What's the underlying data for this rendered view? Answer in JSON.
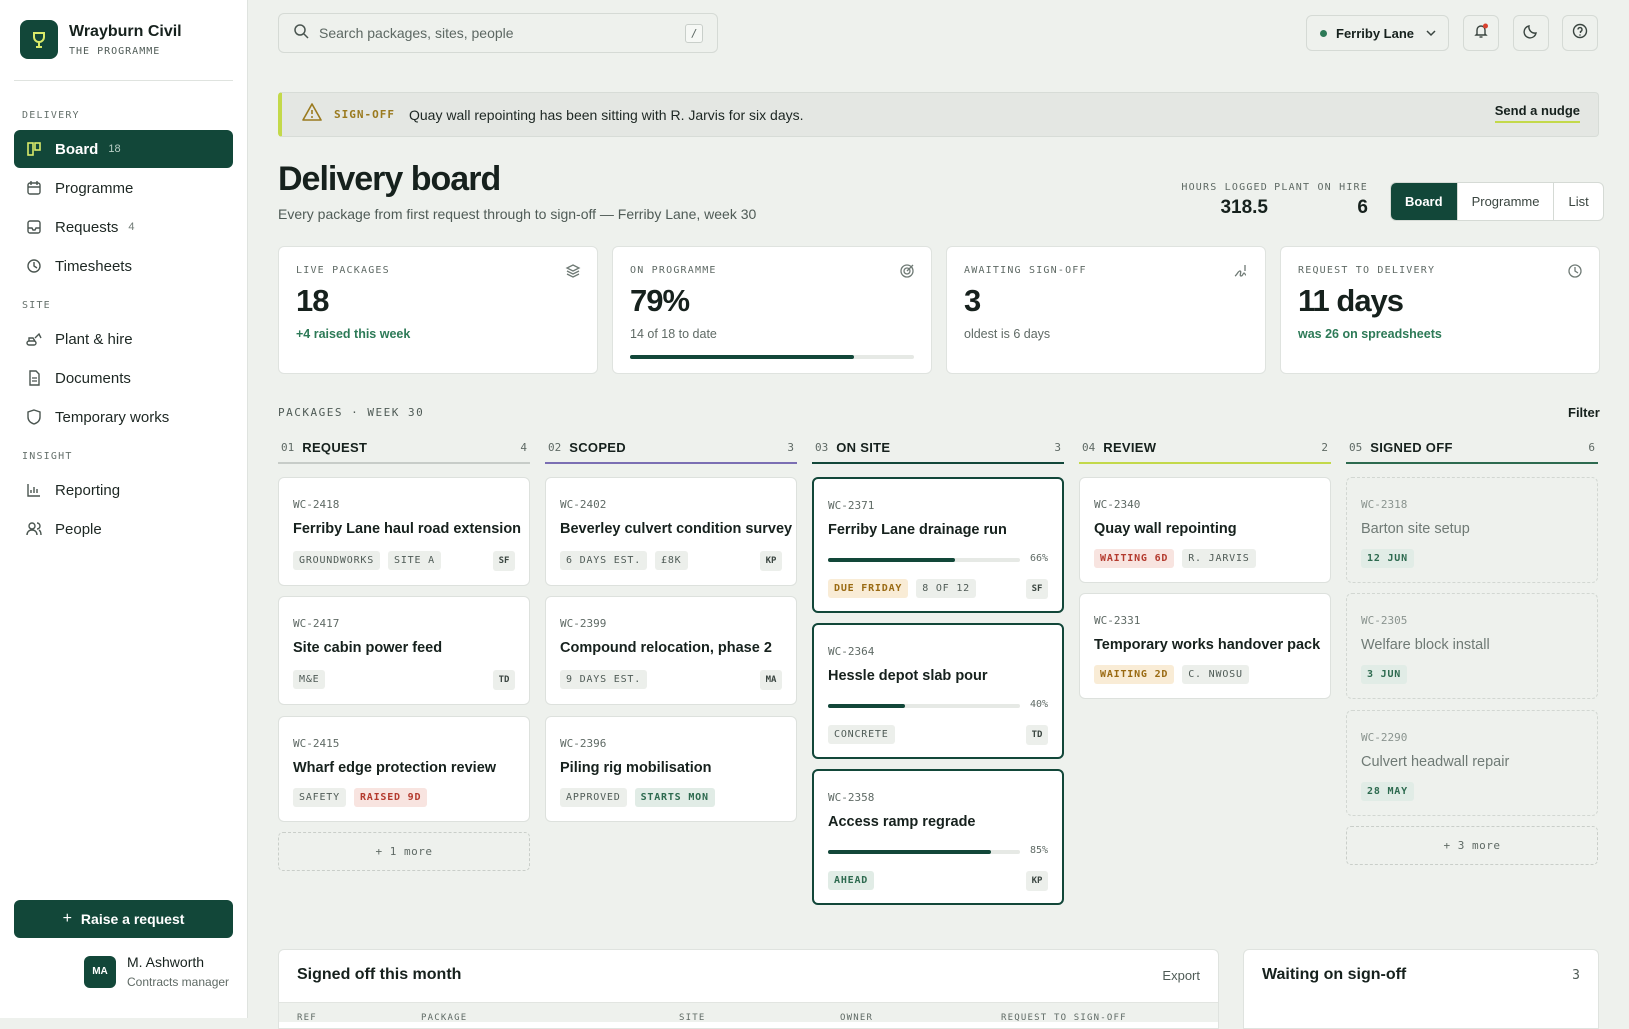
{
  "brand": {
    "name": "Wrayburn Civil",
    "sub": "THE PROGRAMME"
  },
  "sidebar": {
    "sections": [
      "DELIVERY",
      "SITE",
      "INSIGHT"
    ],
    "items": [
      {
        "label": "Board",
        "count": "18",
        "icon": "board-icon"
      },
      {
        "label": "Programme",
        "count": "",
        "icon": "calendar-icon"
      },
      {
        "label": "Requests",
        "count": "4",
        "icon": "inbox-icon"
      },
      {
        "label": "Timesheets",
        "count": "",
        "icon": "clock-icon"
      },
      {
        "label": "Plant & hire",
        "count": "",
        "icon": "excavator-icon"
      },
      {
        "label": "Documents",
        "count": "",
        "icon": "document-icon"
      },
      {
        "label": "Temporary works",
        "count": "",
        "icon": "shield-icon"
      },
      {
        "label": "Reporting",
        "count": "",
        "icon": "chart-icon"
      },
      {
        "label": "People",
        "count": "",
        "icon": "people-icon"
      }
    ],
    "raise_label": "Raise a request",
    "user": {
      "initials": "MA",
      "name": "M. Ashworth",
      "role": "Contracts manager"
    }
  },
  "topbar": {
    "search_placeholder": "Search packages, sites, people",
    "search_key": "/",
    "site": "Ferriby Lane"
  },
  "banner": {
    "tag": "SIGN-OFF",
    "text": "Quay wall repointing has been sitting with R. Jarvis for six days.",
    "action": "Send a nudge"
  },
  "header": {
    "title": "Delivery board",
    "subtitle": "Every package from first request through to sign-off — Ferriby Lane, week 30",
    "hours_label": "HOURS LOGGED",
    "hours_value": "318.5",
    "plant_label": "PLANT ON HIRE",
    "plant_value": "6",
    "views": [
      "Board",
      "Programme",
      "List"
    ]
  },
  "kpis": [
    {
      "label": "LIVE PACKAGES",
      "value": "18",
      "note": "+4 raised this week",
      "icon": "layers-icon"
    },
    {
      "label": "ON PROGRAMME",
      "value": "79%",
      "note": "14 of 18 to date",
      "icon": "target-icon",
      "progress": 0.79
    },
    {
      "label": "AWAITING SIGN-OFF",
      "value": "3",
      "note": "oldest is 6 days",
      "icon": "signature-icon"
    },
    {
      "label": "REQUEST TO DELIVERY",
      "value": "11 days",
      "note": "was 26 on spreadsheets",
      "icon": "history-icon"
    }
  ],
  "board": {
    "label": "PACKAGES · WEEK 30",
    "filter": "Filter",
    "columns": [
      {
        "num": "01",
        "title": "REQUEST",
        "count": "4",
        "more": "+ 1 more",
        "cards": [
          {
            "id": "WC-2418",
            "title": "Ferriby Lane haul road extension",
            "tags": [
              "GROUNDWORKS",
              "SITE A"
            ],
            "owner": "SF"
          },
          {
            "id": "WC-2417",
            "title": "Site cabin power feed",
            "tags": [
              "M&E"
            ],
            "owner": "TD"
          },
          {
            "id": "WC-2415",
            "title": "Wharf edge protection review",
            "tags": [
              "SAFETY",
              "RAISED 9D"
            ],
            "owner": ""
          }
        ]
      },
      {
        "num": "02",
        "title": "SCOPED",
        "count": "3",
        "cards": [
          {
            "id": "WC-2402",
            "title": "Beverley culvert condition survey",
            "tags": [
              "6 DAYS EST.",
              "£8K"
            ],
            "owner": "KP"
          },
          {
            "id": "WC-2399",
            "title": "Compound relocation, phase 2",
            "tags": [
              "9 DAYS EST."
            ],
            "owner": "MA"
          },
          {
            "id": "WC-2396",
            "title": "Piling rig mobilisation",
            "tags": [
              "APPROVED",
              "STARTS MON"
            ],
            "owner": ""
          }
        ]
      },
      {
        "num": "03",
        "title": "ON SITE",
        "count": "3",
        "cards": [
          {
            "id": "WC-2371",
            "title": "Ferriby Lane drainage run",
            "progress": 0.66,
            "pct": "66%",
            "tags": [
              "DUE FRIDAY",
              "8 OF 12"
            ],
            "owner": "SF"
          },
          {
            "id": "WC-2364",
            "title": "Hessle depot slab pour",
            "progress": 0.4,
            "pct": "40%",
            "tags": [
              "CONCRETE"
            ],
            "owner": "TD"
          },
          {
            "id": "WC-2358",
            "title": "Access ramp regrade",
            "progress": 0.85,
            "pct": "85%",
            "tags": [
              "AHEAD"
            ],
            "owner": "KP"
          }
        ]
      },
      {
        "num": "04",
        "title": "REVIEW",
        "count": "2",
        "cards": [
          {
            "id": "WC-2340",
            "title": "Quay wall repointing",
            "tags": [
              "WAITING 6D",
              "R. JARVIS"
            ],
            "owner": ""
          },
          {
            "id": "WC-2331",
            "title": "Temporary works handover pack",
            "tags": [
              "WAITING 2D",
              "C. NWOSU"
            ],
            "owner": ""
          }
        ]
      },
      {
        "num": "05",
        "title": "SIGNED OFF",
        "count": "6",
        "more": "+ 3 more",
        "cards": [
          {
            "id": "WC-2318",
            "title": "Barton site setup",
            "tags": [
              "12 JUN"
            ]
          },
          {
            "id": "WC-2305",
            "title": "Welfare block install",
            "tags": [
              "3 JUN"
            ]
          },
          {
            "id": "WC-2290",
            "title": "Culvert headwall repair",
            "tags": [
              "28 MAY"
            ]
          }
        ]
      }
    ]
  },
  "panels": {
    "signed": {
      "title": "Signed off this month",
      "action": "Export",
      "headers": [
        "REF",
        "PACKAGE",
        "SITE",
        "OWNER",
        "REQUEST TO SIGN-OFF"
      ]
    },
    "waiting": {
      "title": "Waiting on sign-off",
      "count": "3"
    }
  },
  "colors": {
    "accent": "#124739",
    "highlight": "#c3d94a",
    "review": "#c3d94a",
    "scoped": "#7b6fb3",
    "alert": "#d9412e"
  }
}
